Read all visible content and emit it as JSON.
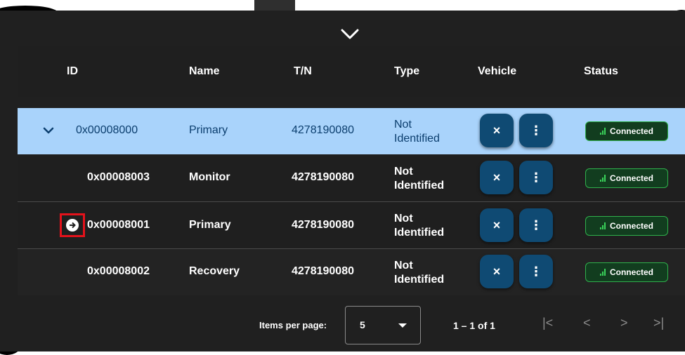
{
  "table": {
    "headers": {
      "id": "ID",
      "name": "Name",
      "tn": "T/N",
      "type": "Type",
      "vehicle": "Vehicle",
      "status": "Status"
    },
    "rows": [
      {
        "id": "0x00008000",
        "name": "Primary",
        "tn": "4278190080",
        "type_line1": "Not",
        "type_line2": "Identified",
        "status": "Connected",
        "selected": true
      },
      {
        "id": "0x00008003",
        "name": "Monitor",
        "tn": "4278190080",
        "type_line1": "Not",
        "type_line2": "Identified",
        "status": "Connected",
        "selected": false
      },
      {
        "id": "0x00008001",
        "name": "Primary",
        "tn": "4278190080",
        "type_line1": "Not",
        "type_line2": "Identified",
        "status": "Connected",
        "selected": false
      },
      {
        "id": "0x00008002",
        "name": "Recovery",
        "tn": "4278190080",
        "type_line1": "Not",
        "type_line2": "Identified",
        "status": "Connected",
        "selected": false
      }
    ],
    "vehicle_buttons": {
      "remove_glyph": "×",
      "more_glyph": "⋮"
    }
  },
  "paginator": {
    "items_per_page_label": "Items per page:",
    "items_per_page_value": "5",
    "range_label": "1 – 1 of 1",
    "first_glyph": "|<",
    "prev_glyph": "<",
    "next_glyph": ">",
    "last_glyph": ">|"
  },
  "colors": {
    "selected_row": "#a9d3fb",
    "vehicle_button": "#0f4a73",
    "status_green": "#2fb04b",
    "highlight_red": "#e3121b"
  },
  "icons": [
    "chevron-down-icon",
    "expand-chevron-icon",
    "arrow-right-circle-icon",
    "close-icon",
    "more-vert-icon",
    "signal-bars-icon"
  ]
}
